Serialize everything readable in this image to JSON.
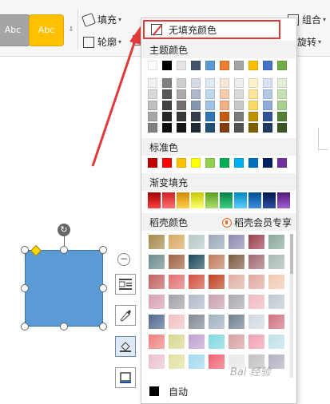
{
  "ribbon": {
    "style_button_1_label": "Abc",
    "style_button_2_label": "Abc",
    "fill_label": "填充",
    "outline_label": "轮廓",
    "group_label": "组合",
    "rotate_label": "旋转"
  },
  "dropdown": {
    "no_fill_label": "无填充颜色",
    "theme_colors_header": "主题颜色",
    "standard_colors_header": "标准色",
    "gradient_fill_header": "渐变填充",
    "daoke_colors_header": "稻壳颜色",
    "vip_label": "稻壳会员专享",
    "auto_label": "自动",
    "theme_top_row": [
      "#ffffff",
      "#000000",
      "#e7e6e6",
      "#44546a",
      "#5b9bd5",
      "#ed7d31",
      "#a5a5a5",
      "#ffc000",
      "#4472c4",
      "#70ad47"
    ],
    "theme_columns": [
      [
        "#f2f2f2",
        "#d9d9d9",
        "#bfbfbf",
        "#a6a6a6",
        "#808080"
      ],
      [
        "#808080",
        "#595959",
        "#404040",
        "#262626",
        "#0d0d0d"
      ],
      [
        "#d0cece",
        "#aeaaaa",
        "#757171",
        "#3a3838",
        "#171616"
      ],
      [
        "#d6dce4",
        "#adb9ca",
        "#8497b0",
        "#333f4f",
        "#222a35"
      ],
      [
        "#deebf6",
        "#bdd7ee",
        "#9dc3e6",
        "#2e75b5",
        "#1f4e79"
      ],
      [
        "#fbe5d5",
        "#f8cbad",
        "#f4b183",
        "#c55a11",
        "#833c0b"
      ],
      [
        "#ededed",
        "#dbdbdb",
        "#c9c9c9",
        "#7b7b7b",
        "#525252"
      ],
      [
        "#fff2cc",
        "#fee599",
        "#ffd965",
        "#bf9000",
        "#7f6000"
      ],
      [
        "#dae3f3",
        "#b4c7e7",
        "#8faadc",
        "#2f5597",
        "#203864"
      ],
      [
        "#e2efd9",
        "#c5e0b3",
        "#a9d18e",
        "#538135",
        "#375623"
      ]
    ],
    "standard_colors": [
      "#c00000",
      "#ff0000",
      "#ffc000",
      "#ffff00",
      "#92d050",
      "#00b050",
      "#00b0f0",
      "#0070c0",
      "#002060",
      "#7030a0"
    ],
    "gradient_colors": [
      [
        "#a00000",
        "#ff4040"
      ],
      [
        "#d02020",
        "#ff7070"
      ],
      [
        "#d08a00",
        "#ffd050"
      ],
      [
        "#c8c800",
        "#ffff70"
      ],
      [
        "#5aa020",
        "#b0e070"
      ],
      [
        "#008040",
        "#40d080"
      ],
      [
        "#0088c0",
        "#60d0ff"
      ],
      [
        "#004c90",
        "#4090e0"
      ],
      [
        "#001850",
        "#3050a0"
      ],
      [
        "#501878",
        "#a060d0"
      ]
    ],
    "texture_rows": [
      [
        "#a48a4a",
        "#d8a860",
        "#b8c8c8",
        "#9aa8b8",
        "#8a8ab0",
        "#9a4050",
        "#8aa898"
      ],
      [
        "#6a8a8a",
        "#a06040",
        "#1a4a5a",
        "#c07a5a",
        "#7a5a40",
        "#a06a70",
        "#a8b8b0"
      ],
      [
        "#c06060",
        "#e07070",
        "#d05040",
        "#c04020",
        "#e0b0a0",
        "#e0a8a0",
        "#f0c8b0"
      ],
      [
        "#d8a0b0",
        "#a0a0a8",
        "#b0b8c8",
        "#c8a0b0",
        "#a8a8b0",
        "#f0b8c0",
        "#c0c8d0"
      ],
      [
        "#506890",
        "#f0c0c0",
        "#808890",
        "#a0b0c0",
        "#708090",
        "#d0d8e0",
        "#d07080"
      ],
      [
        "#f08080",
        "#d8d890",
        "#c0a0d0",
        "#80d8e0",
        "#d8a0a0",
        "#f0a0b0",
        "#c0e0e8"
      ],
      [
        "#e8c0d0",
        "#e0e0a0",
        "#a0d8f0",
        "#f06070",
        "#e8e8e8",
        "#c0c0c0",
        "#b0b0c0"
      ]
    ],
    "colors": {
      "highlight_border": "#e23a3a",
      "section_bg": "#f2f2f2",
      "shape_fill": "#5b9bd5",
      "style_button_1": "#a5a5a5",
      "style_button_2": "#ffc000",
      "arrow": "#e23a3a"
    }
  },
  "watermark": "Bai 经验"
}
